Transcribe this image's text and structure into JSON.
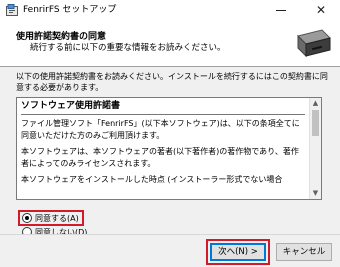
{
  "window": {
    "title": "FenrirFS セットアップ",
    "close_glyph": "✕"
  },
  "header": {
    "title": "使用許諾契約書の同意",
    "subtitle": "続行する前に以下の重要な情報をお読みください。"
  },
  "content": {
    "intro": "以下の使用許諾契約書をお読みください。インストールを続行するにはこの契約書に同意する必要があります。",
    "license": {
      "heading": "ソフトウェア使用許諾書",
      "paragraphs": [
        "ファイル管理ソフト「FenrirFS」(以下本ソフトウェア)は、以下の条項全てに同意いただけた方のみご利用頂けます。",
        "本ソフトウェアは、本ソフトウェアの著者(以下著作者)の著作物であり、著作者によってのみライセンスされます。",
        "本ソフトウェアをインストールした時点 (インストーラー形式でない場合"
      ]
    },
    "scroll_up_glyph": "▲",
    "scroll_down_glyph": "▼",
    "options": {
      "agree_label": "同意する(A)",
      "disagree_label": "同意しない(D)",
      "selected": "agree"
    }
  },
  "footer": {
    "next_label": "次へ(N) >",
    "cancel_label": "キャンセル"
  },
  "colors": {
    "highlight": "#d01c2a",
    "focus_border": "#0078d7"
  }
}
